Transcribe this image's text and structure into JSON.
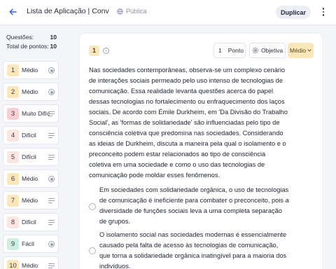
{
  "header": {
    "title": "Lista de Aplicação | Conviv...",
    "visibility": "Pública",
    "duplicate_label": "Duplicar"
  },
  "sidebar": {
    "questions_label": "Questões:",
    "questions_value": "10",
    "points_label": "Total de pontos:",
    "points_value": "10",
    "items": [
      {
        "num": "1",
        "difficulty": "Médio",
        "type": "objective",
        "color": "#fbe7b9"
      },
      {
        "num": "2",
        "difficulty": "Médio",
        "type": "objective",
        "color": "#fbe7b9"
      },
      {
        "num": "3",
        "difficulty": "Muito Difícil",
        "type": "text",
        "color": "#f8cfd2"
      },
      {
        "num": "4",
        "difficulty": "Difícil",
        "type": "text",
        "color": "#fde6e2"
      },
      {
        "num": "5",
        "difficulty": "Difícil",
        "type": "text",
        "color": "#fde6e2"
      },
      {
        "num": "6",
        "difficulty": "Médio",
        "type": "objective",
        "color": "#fbe7b9"
      },
      {
        "num": "7",
        "difficulty": "Médio",
        "type": "text",
        "color": "#fbe7b9"
      },
      {
        "num": "8",
        "difficulty": "Difícil",
        "type": "text",
        "color": "#fde6e2"
      },
      {
        "num": "9",
        "difficulty": "Fácil",
        "type": "objective",
        "color": "#cdeee0"
      },
      {
        "num": "10",
        "difficulty": "Médio",
        "type": "text",
        "color": "#fbe7b9"
      }
    ]
  },
  "question": {
    "number": "1",
    "points_value": "1",
    "points_label": "Ponto",
    "type_label": "Objetiva",
    "level_label": "Médio",
    "statement": "Nas sociedades contemporâneas, observa-se um complexo cenário de interações sociais permeado pelo uso intenso de tecnologias de comunicação. Essa realidade levanta questões acerca do papel dessas tecnologias no fortalecimento ou enfraquecimento dos laços sociais. De acordo com Émile Durkheim, em 'Da Divisão do Trabalho Social', as 'formas de solidariedade' são influenciadas pelo tipo de consciência coletiva que predomina nas sociedades. Considerando as ideias de Durkheim, discuta a maneira pela qual o isolamento e o preconceito podem estar relacionados ao tipo de consciência coletiva em uma sociedade e como o uso das tecnologias de comunicação pode moldar esses fenômenos.",
    "options": [
      {
        "text": "Em sociedades com solidariedade orgânica, o uso de tecnologias de comunicação é ineficiente para combater o preconceito, pois a diversidade de funções sociais leva a uma completa separação de grupos."
      },
      {
        "text": "O isolamento social nas sociedades modernas é essencialmente causado pela falta de acesso às tecnologias de comunicação, que torna a solidariedade orgânica inatingível para a maioria dos indivíduos."
      }
    ]
  }
}
